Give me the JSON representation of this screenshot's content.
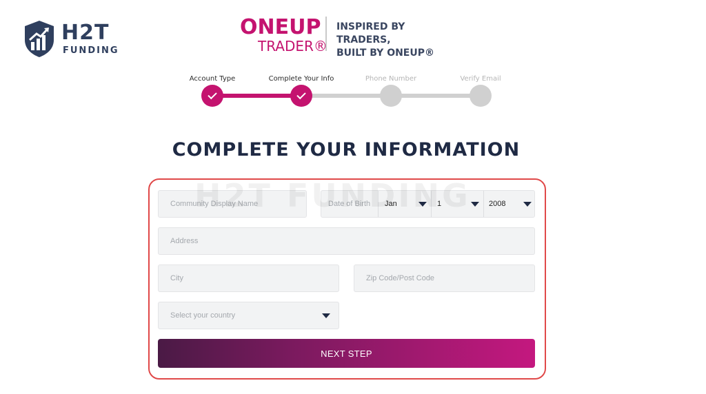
{
  "brand": {
    "name": "H2T",
    "subtitle": "FUNDING"
  },
  "partner": {
    "line1": "ONEUP",
    "line2": "TRADER®",
    "tagline1": "INSPIRED BY TRADERS,",
    "tagline2": "BUILT BY ONEUP®"
  },
  "stepper": {
    "steps": [
      {
        "label": "Account Type",
        "state": "done"
      },
      {
        "label": "Complete Your Info",
        "state": "done"
      },
      {
        "label": "Phone Number",
        "state": "todo"
      },
      {
        "label": "Verify Email",
        "state": "todo"
      }
    ]
  },
  "heading": "COMPLETE YOUR INFORMATION",
  "watermark": "H2T FUNDING",
  "form": {
    "display_name_placeholder": "Community Display Name",
    "dob_label": "Date of Birth",
    "dob_month": "Jan",
    "dob_day": "1",
    "dob_year": "2008",
    "address_placeholder": "Address",
    "city_placeholder": "City",
    "zip_placeholder": "Zip Code/Post Code",
    "country_placeholder": "Select your country",
    "next_label": "NEXT STEP"
  },
  "colors": {
    "accent": "#c4136f",
    "heading": "#1f2a44",
    "highlight_border": "#e04848"
  },
  "icons": {
    "brand": "shield-chart-icon",
    "step_done": "check-icon",
    "dropdown": "caret-down-icon"
  }
}
